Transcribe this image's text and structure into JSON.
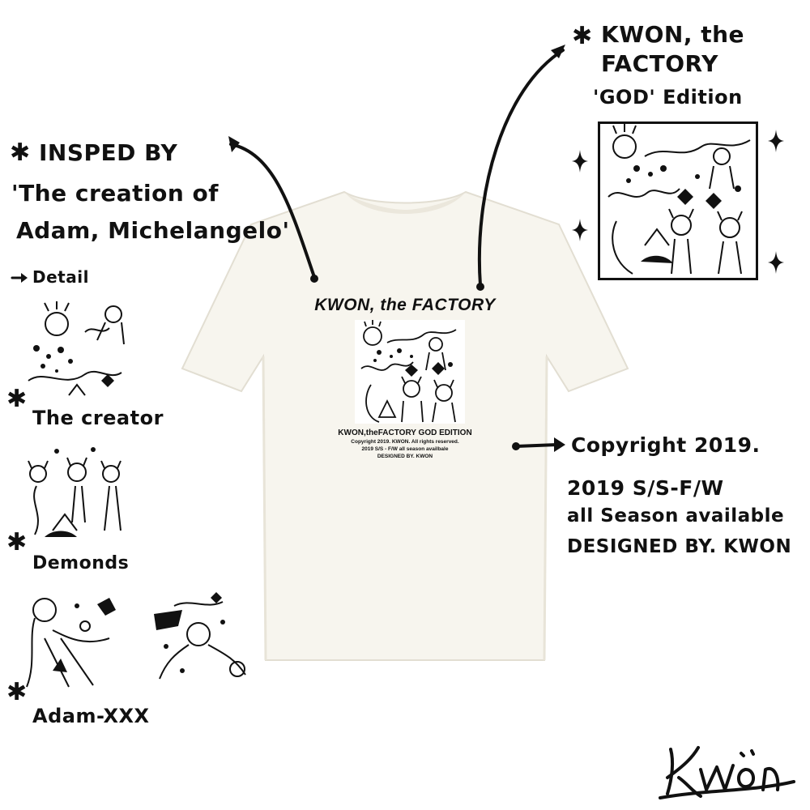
{
  "left_annotation": {
    "heading": "INSPED BY",
    "line1": "'The creation of",
    "line2": "Adam, Michelangelo'",
    "detail_label": "Detail"
  },
  "details": [
    {
      "caption": "The creator"
    },
    {
      "caption": "Demonds"
    },
    {
      "caption": "Adam-XXX"
    }
  ],
  "right_annotation": {
    "line1": "KWON, the",
    "line2": "FACTORY",
    "line3": "'GOD' Edition"
  },
  "shirt_print": {
    "headline": "KWON, the FACTORY",
    "edition": "KWON,theFACTORY GOD EDITION",
    "copyright": "Copyright 2019. KWON. All rights reserved.",
    "season": "2019 S/S - F/W all season availbale",
    "designer": "DESIGNED BY. KWON"
  },
  "copyright_annotation": {
    "line1": "Copyright 2019.",
    "line2": "2019 S/S-F/W",
    "line3": "all Season available",
    "line4": "DESIGNED BY. KWON"
  },
  "signature": "KWON",
  "icons": [
    "asterisk-icon",
    "arrow-icon",
    "sparkle-icon"
  ],
  "colors": {
    "ink": "#111111",
    "shirt": "#f7f5ee",
    "shirt_shadow": "#e6e2d6"
  }
}
